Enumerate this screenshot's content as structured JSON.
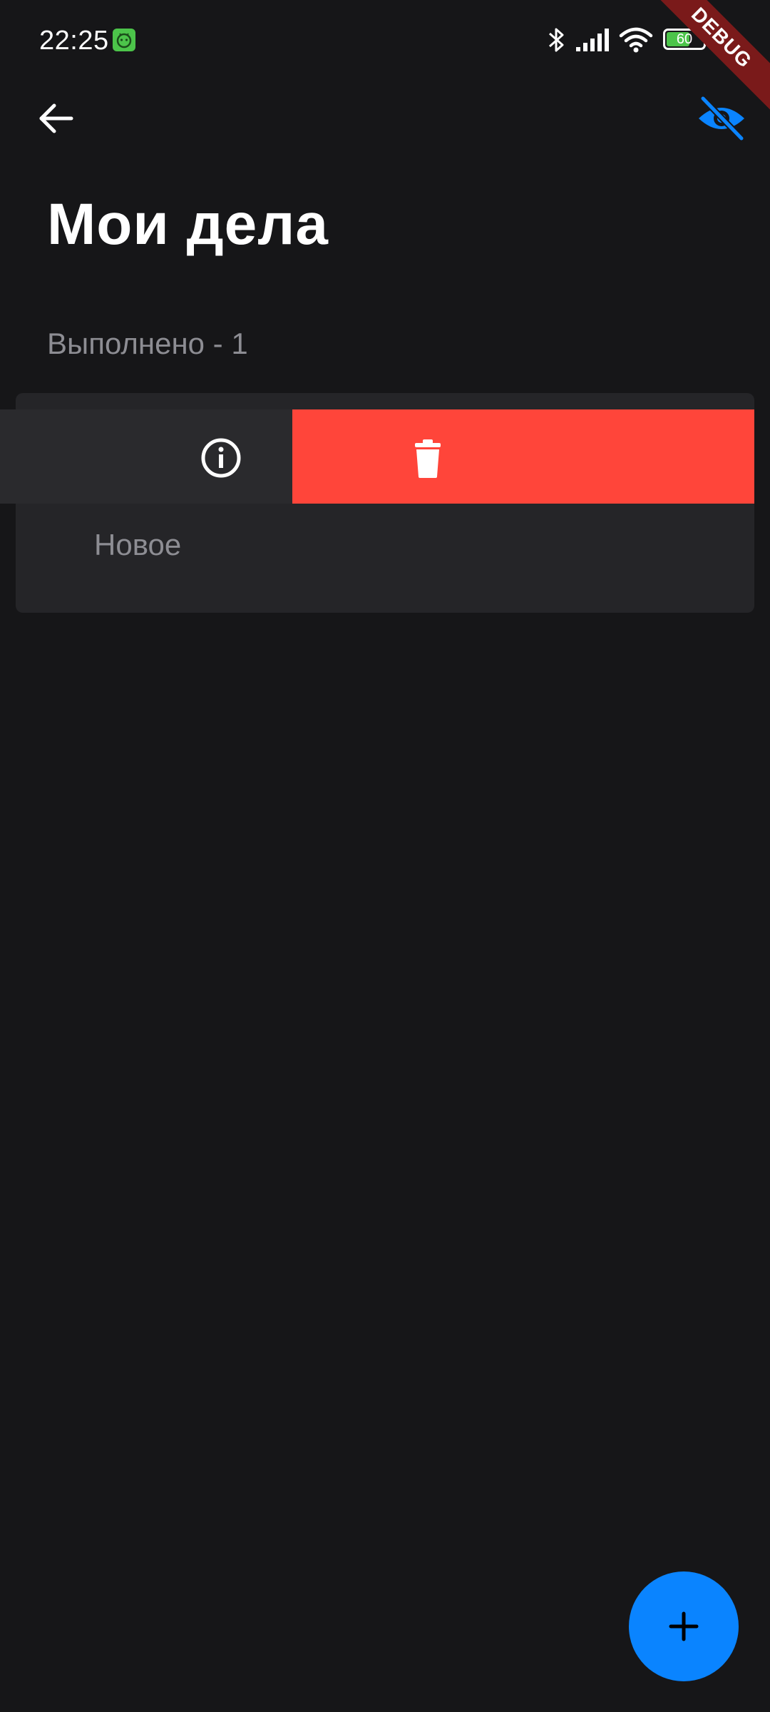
{
  "status_bar": {
    "time": "22:25",
    "battery_level": "60",
    "icons": [
      "android-notification-icon",
      "bluetooth-icon",
      "signal-icon",
      "wifi-icon",
      "battery-icon"
    ]
  },
  "debug_banner": {
    "label": "DEBUG"
  },
  "app_bar": {
    "back_icon": "arrow-back-icon",
    "visibility_icon": "visibility-off-icon"
  },
  "header": {
    "title": "Мои дела",
    "done_counter": "Выполнено - 1"
  },
  "tasks": [
    {
      "label": "Новое",
      "swipe_actions": {
        "info_icon": "info-icon",
        "delete_icon": "trash-icon"
      }
    }
  ],
  "fab": {
    "icon": "plus-icon"
  },
  "colors": {
    "background": "#161618",
    "card": "#252528",
    "accent_blue": "#0a84ff",
    "delete_red": "#ff453a",
    "secondary_text": "#8d8d93",
    "debug_ribbon": "#7a1a1a"
  }
}
